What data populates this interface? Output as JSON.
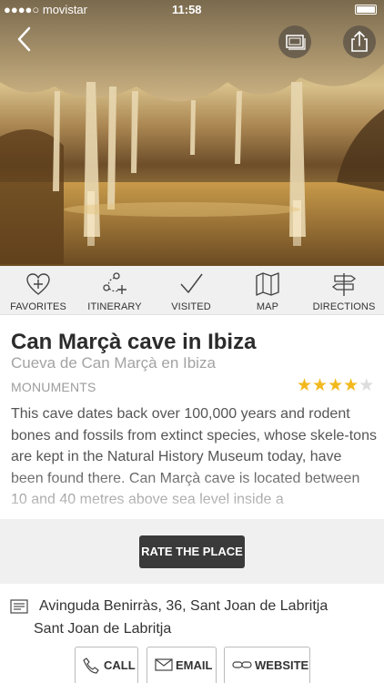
{
  "status_bar": {
    "carrier": "●●●●○ movistar",
    "time": "11:58"
  },
  "hero": {
    "back_icon": "chevron-left-icon",
    "gallery_icon": "photo-stack-icon",
    "share_icon": "share-icon"
  },
  "actions": [
    {
      "label": "FAVORITES",
      "icon": "heart-plus-icon"
    },
    {
      "label": "ITINERARY",
      "icon": "route-icon"
    },
    {
      "label": "VISITED",
      "icon": "checkmark-icon"
    },
    {
      "label": "MAP",
      "icon": "map-icon"
    },
    {
      "label": "DIRECTIONS",
      "icon": "signpost-icon"
    }
  ],
  "place": {
    "title": "Can Marçà cave in Ibiza",
    "subtitle": "Cueva de Can Marçà en Ibiza",
    "category": "MONUMENTS",
    "rating": 4,
    "rating_max": 5,
    "description": "This cave dates back over 100,000 years and rodent bones and fossils from extinct species, whose skele-tons are kept in the Natural History Museum today, have been found there. Can Marçà cave is located between 10 and 40 metres above sea level inside a"
  },
  "rate_button": "RATE THE PLACE",
  "address": {
    "line1": "Avinguda Benirràs, 36, Sant Joan de Labritja",
    "line2": "Sant Joan de Labritja"
  },
  "contact": {
    "call": "CALL",
    "email": "EMAIL",
    "website": "WEBSITE"
  },
  "colors": {
    "star": "#f2b81c",
    "button_dark": "#3a3a3a",
    "bar_bg": "#f0f0f0"
  }
}
